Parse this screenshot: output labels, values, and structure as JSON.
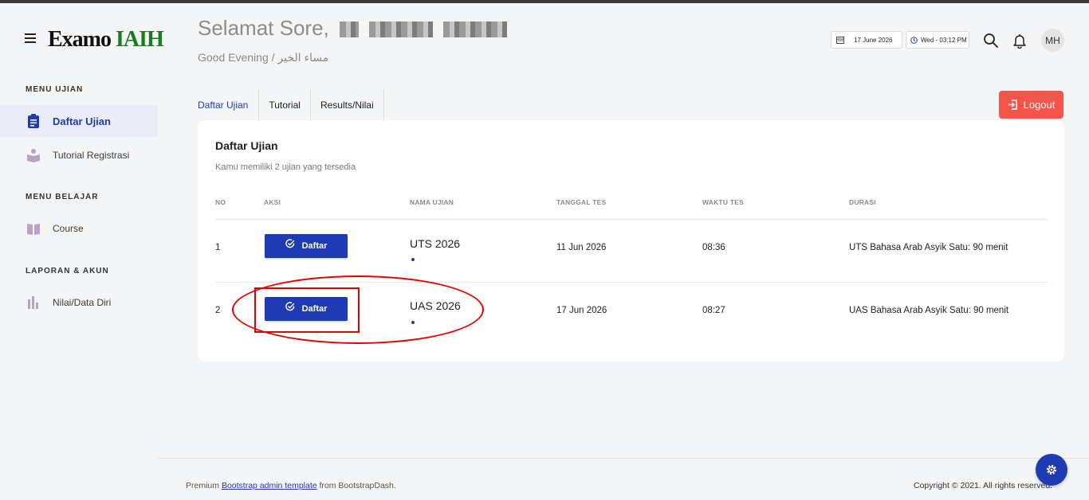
{
  "app": {
    "logo_part1": "Examo",
    "logo_part2": "IAIH"
  },
  "sidebar": {
    "sections": [
      {
        "heading": "MENU UJIAN",
        "items": [
          {
            "label": "Daftar Ujian",
            "icon": "clipboard-icon"
          },
          {
            "label": "Tutorial Registrasi",
            "icon": "reader-icon"
          }
        ]
      },
      {
        "heading": "MENU BELAJAR",
        "items": [
          {
            "label": "Course",
            "icon": "book-icon"
          }
        ]
      },
      {
        "heading": "LAPORAN & AKUN",
        "items": [
          {
            "label": "Nilai/Data Diri",
            "icon": "bar-chart-icon"
          }
        ]
      }
    ]
  },
  "header": {
    "greeting": "Selamat Sore,",
    "subgreeting": "Good Evening / مساء الخير",
    "date": "17 June 2026",
    "time": "Wed - 03:12 PM",
    "avatar_initials": "MH"
  },
  "tabs": [
    {
      "label": "Daftar Ujian"
    },
    {
      "label": "Tutorial"
    },
    {
      "label": "Results/Nilai"
    }
  ],
  "logout_label": "Logout",
  "card": {
    "title": "Daftar Ujian",
    "subtitle": "Kamu memiliki 2 ujian yang tersedia",
    "columns": [
      "NO",
      "AKSI",
      "NAMA UJIAN",
      "TANGGAL TES",
      "WAKTU TES",
      "DURASI"
    ],
    "rows": [
      {
        "no": "1",
        "action": "Daftar",
        "name": "UTS 2026",
        "date": "11 Jun 2026",
        "time": "08:36",
        "duration": "UTS Bahasa Arab Asyik Satu: 90 menit"
      },
      {
        "no": "2",
        "action": "Daftar",
        "name": "UAS 2026",
        "date": "17 Jun 2026",
        "time": "08:27",
        "duration": "UAS Bahasa Arab Asyik Satu: 90 menit"
      }
    ]
  },
  "footer": {
    "left_prefix": "Premium",
    "left_link": "Bootstrap admin template",
    "left_suffix": "from BootstrapDash.",
    "right": "Copyright © 2021. All rights reserved."
  },
  "colors": {
    "primary": "#1f3bb3",
    "logout": "#f1554c",
    "annotation": "#e00000",
    "logo_green": "#1d7a1d"
  }
}
